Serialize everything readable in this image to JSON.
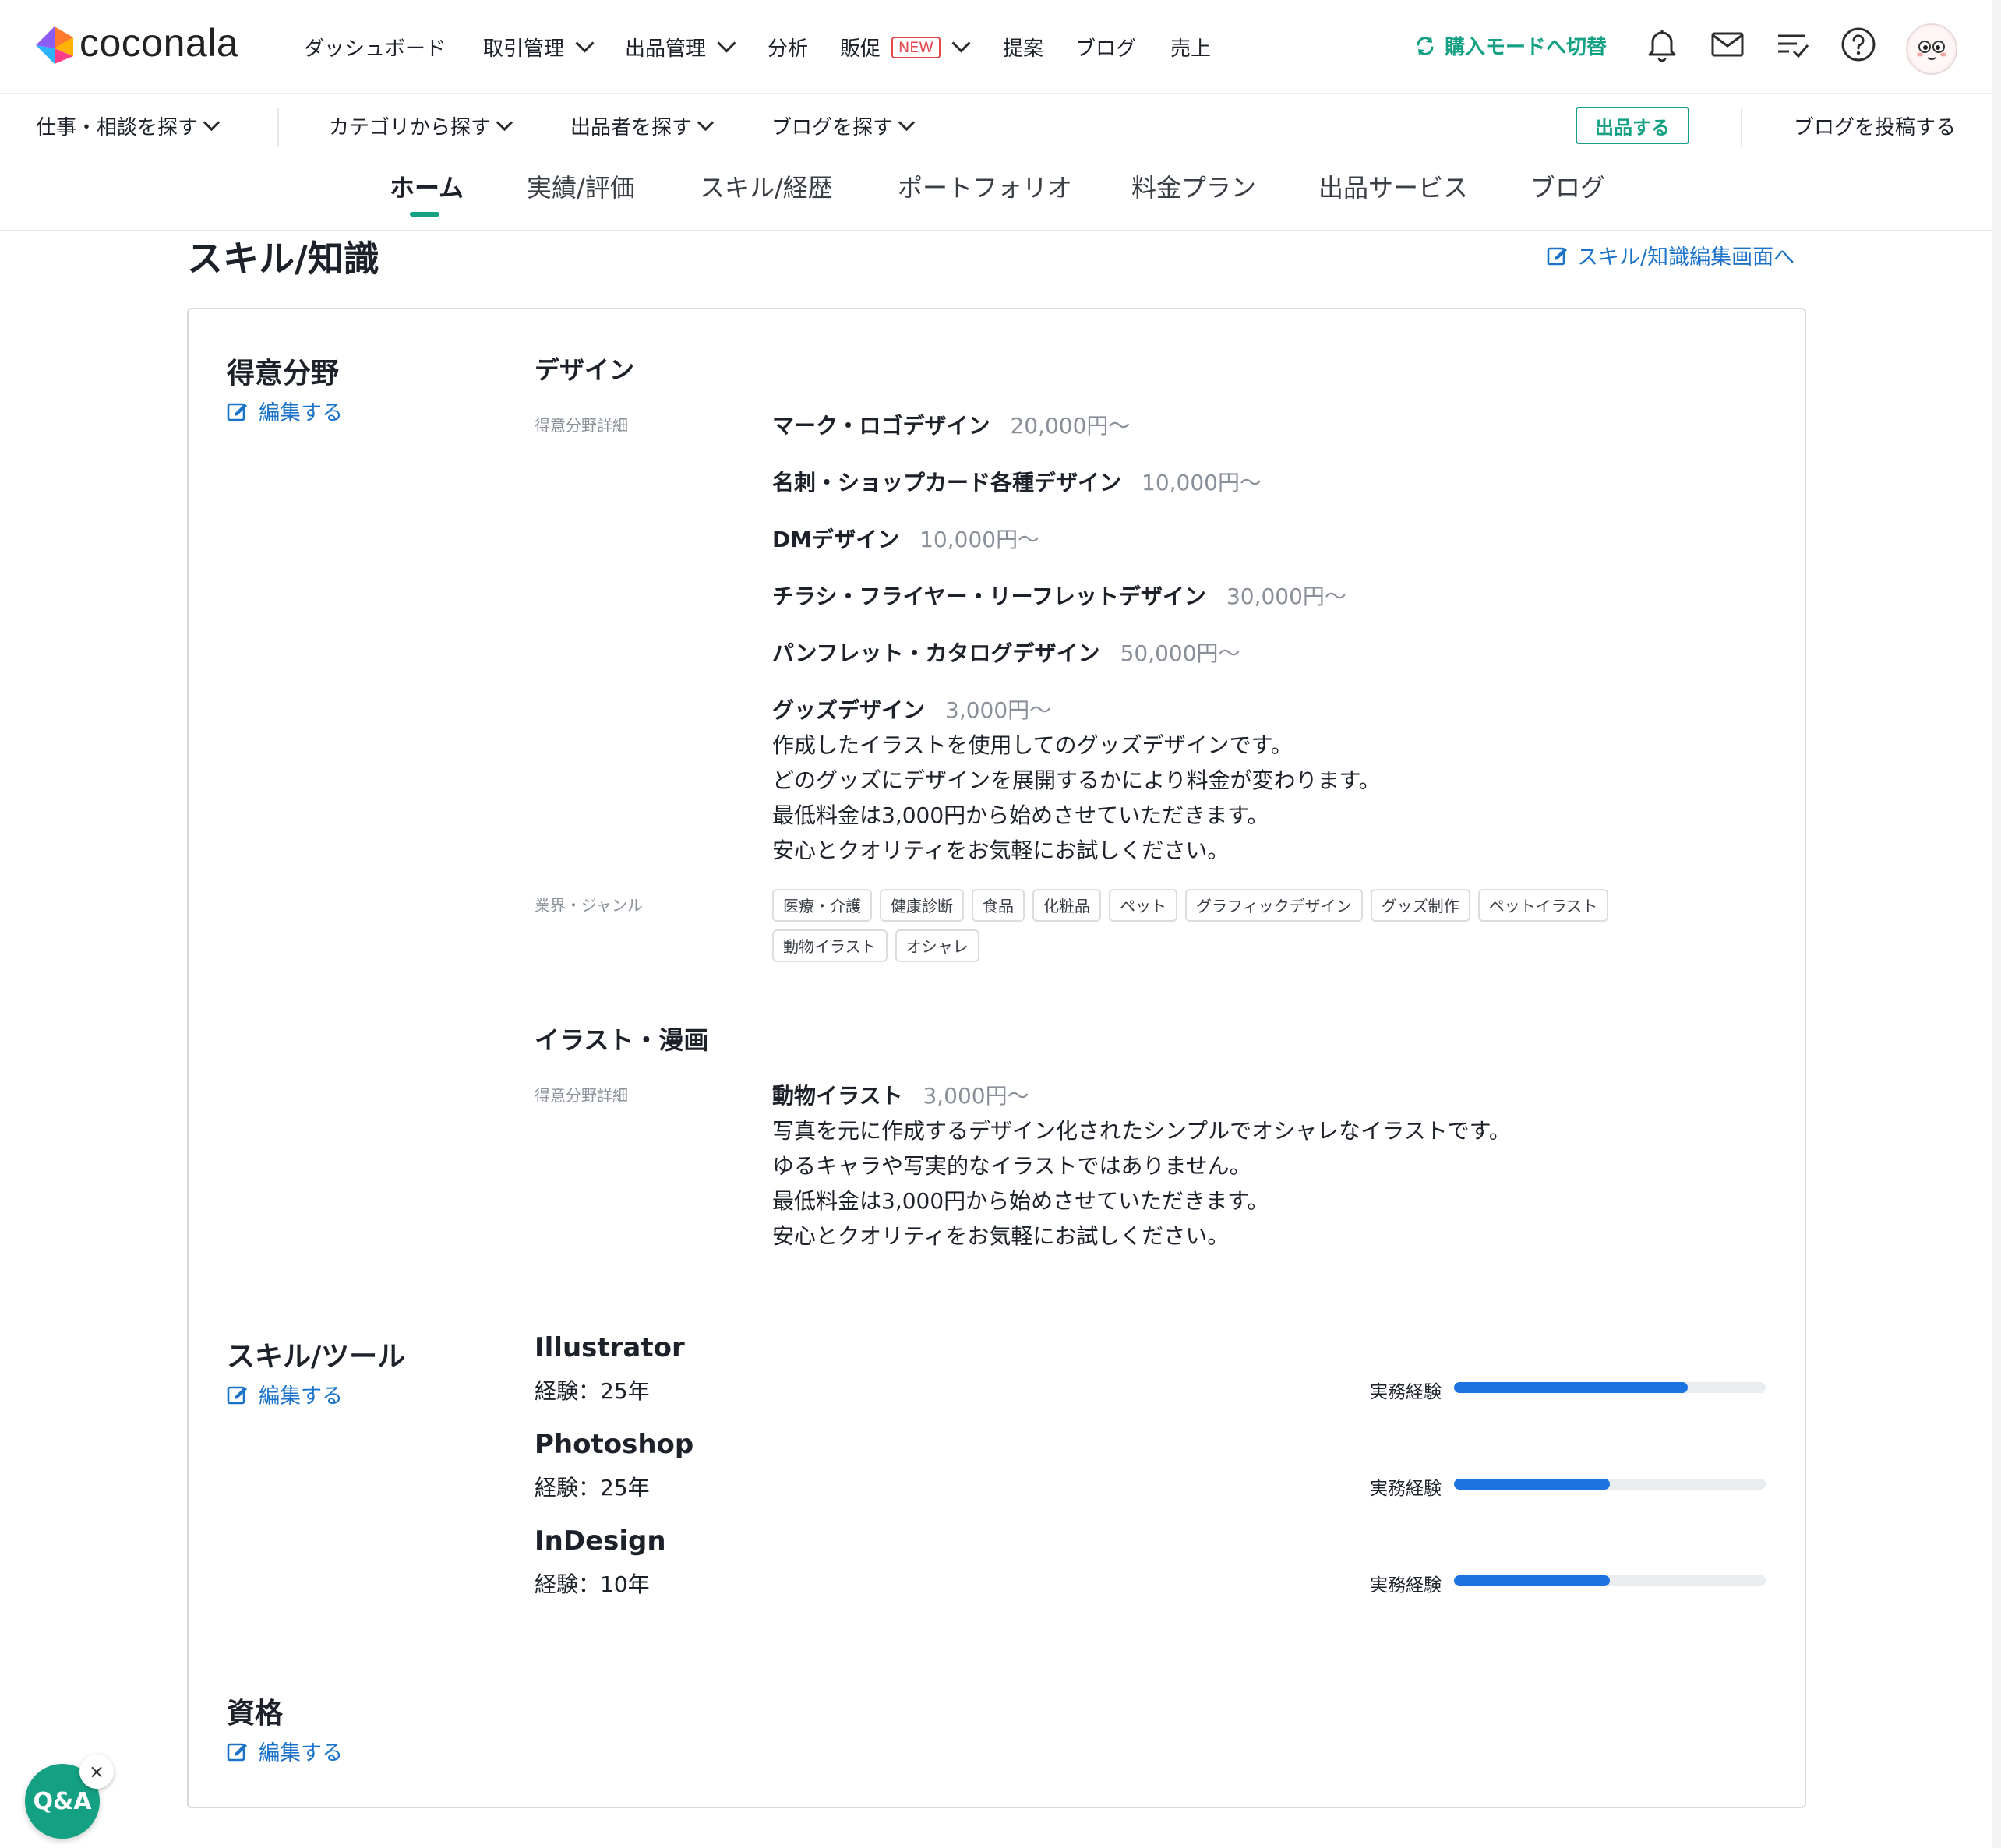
{
  "brand": {
    "name": "coconala",
    "colors": {
      "accent": "#14a083",
      "link": "#1a73c9",
      "bar": "#1a73e0",
      "badge": "#e5484d"
    }
  },
  "topnav": {
    "items": [
      {
        "label": "ダッシュボード"
      },
      {
        "label": "取引管理"
      },
      {
        "label": "出品管理"
      },
      {
        "label": "分析"
      },
      {
        "label": "販促",
        "badge": "NEW"
      },
      {
        "label": "提案"
      },
      {
        "label": "ブログ"
      },
      {
        "label": "売上"
      }
    ],
    "switch_mode": "購入モードへ切替",
    "icons": [
      "refresh-icon",
      "bell-icon",
      "mail-icon",
      "list-check-icon",
      "help-icon",
      "avatar"
    ]
  },
  "subnav": {
    "items": [
      {
        "label": "仕事・相談を探す"
      },
      {
        "label": "カテゴリから探す"
      },
      {
        "label": "出品者を探す"
      },
      {
        "label": "ブログを探す"
      }
    ],
    "sell_button": "出品する",
    "post_blog": "ブログを投稿する"
  },
  "tabs": [
    {
      "label": "ホーム",
      "active": true
    },
    {
      "label": "実績/評価"
    },
    {
      "label": "スキル/経歴"
    },
    {
      "label": "ポートフォリオ"
    },
    {
      "label": "料金プラン"
    },
    {
      "label": "出品サービス"
    },
    {
      "label": "ブログ"
    }
  ],
  "section": {
    "title": "スキル/知識",
    "edit_link": "スキル/知識編集画面へ"
  },
  "specialties": {
    "title": "得意分野",
    "edit": "編集する",
    "categories": [
      {
        "name": "デザイン",
        "detail_label": "得意分野詳細",
        "items": [
          {
            "name": "マーク・ロゴデザイン",
            "price": "20,000円〜"
          },
          {
            "name": "名刺・ショップカード各種デザイン",
            "price": "10,000円〜"
          },
          {
            "name": "DMデザイン",
            "price": "10,000円〜"
          },
          {
            "name": "チラシ・フライヤー・リーフレットデザイン",
            "price": "30,000円〜"
          },
          {
            "name": "パンフレット・カタログデザイン",
            "price": "50,000円〜"
          },
          {
            "name": "グッズデザイン",
            "price": "3,000円〜",
            "desc": "作成したイラストを使用してのグッズデザインです。\nどのグッズにデザインを展開するかにより料金が変わります。\n最低料金は3,000円から始めさせていただきます。\n安心とクオリティをお気軽にお試しください。"
          }
        ],
        "genre_label": "業界・ジャンル",
        "genres": [
          "医療・介護",
          "健康診断",
          "食品",
          "化粧品",
          "ペット",
          "グラフィックデザイン",
          "グッズ制作",
          "ペットイラスト",
          "動物イラスト",
          "オシャレ"
        ]
      },
      {
        "name": "イラスト・漫画",
        "detail_label": "得意分野詳細",
        "items": [
          {
            "name": "動物イラスト",
            "price": "3,000円〜",
            "desc": "写真を元に作成するデザイン化されたシンプルでオシャレなイラストです。\nゆるキャラや写実的なイラストではありません。\n最低料金は3,000円から始めさせていただきます。\n安心とクオリティをお気軽にお試しください。"
          }
        ]
      }
    ]
  },
  "skills": {
    "title": "スキル/ツール",
    "edit": "編集する",
    "practical_label": "実務経験",
    "tools": [
      {
        "name": "Illustrator",
        "experience": "経験：25年",
        "level": 0.75
      },
      {
        "name": "Photoshop",
        "experience": "経験：25年",
        "level": 0.5
      },
      {
        "name": "InDesign",
        "experience": "経験：10年",
        "level": 0.5
      }
    ]
  },
  "qualifications": {
    "title": "資格",
    "edit": "編集する"
  },
  "qa_button": {
    "label": "Q&A",
    "close": "×"
  }
}
